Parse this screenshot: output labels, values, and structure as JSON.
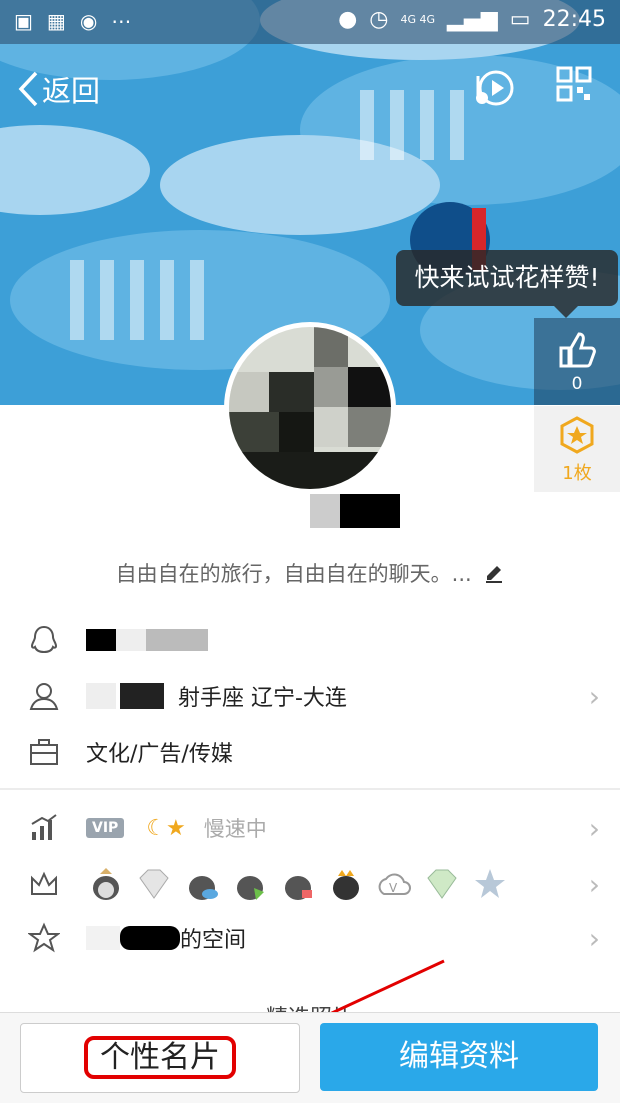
{
  "status_bar": {
    "network": "4G 4G",
    "time": "22:45"
  },
  "header": {
    "back_label": "返回"
  },
  "tooltip": "快来试试花样赞!",
  "likes": {
    "count": "0"
  },
  "badge": {
    "count": "1枚"
  },
  "profile": {
    "signature": "自由自在的旅行，自由自在的聊天。..."
  },
  "info_rows": {
    "profile_detail": "射手座  辽宁-大连",
    "industry": "文化/广告/传媒"
  },
  "vip_row": {
    "vip_tag": "VIP",
    "speed_text": "慢速中"
  },
  "space_row": {
    "suffix": "的空间"
  },
  "section_peek": "精选照片",
  "bottom": {
    "card_button": "个性名片",
    "edit_button": "编辑资料"
  },
  "annotation_color": "#e20000",
  "accent_color": "#2aa8e9"
}
